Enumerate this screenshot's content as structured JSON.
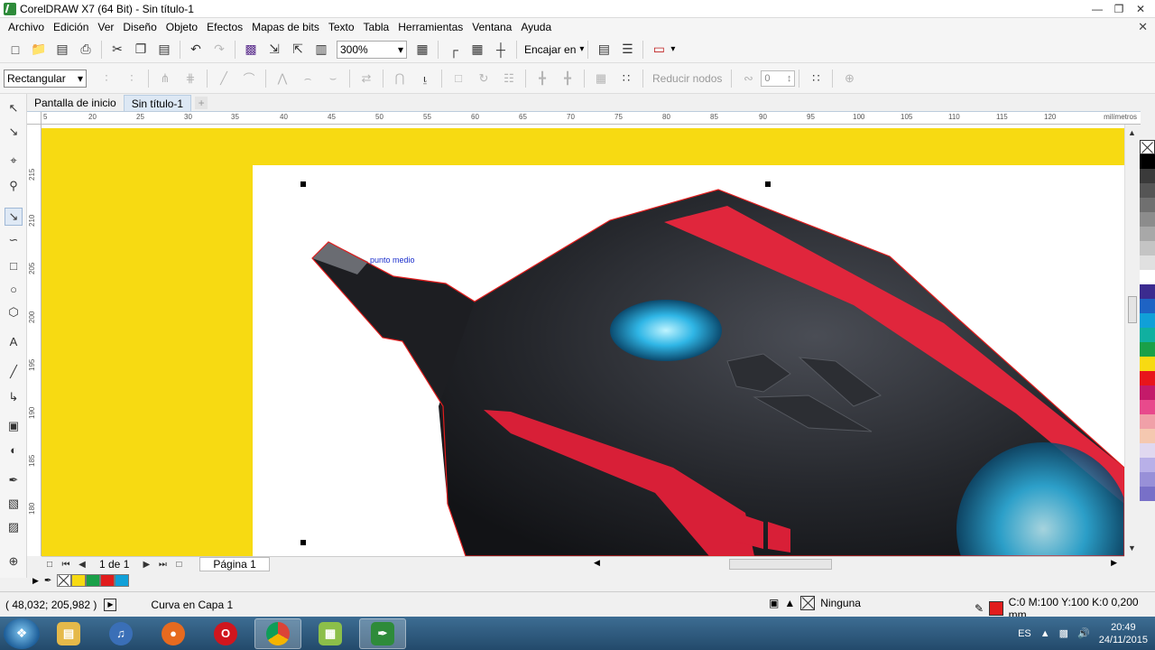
{
  "window": {
    "title": "CorelDRAW X7 (64 Bit) - Sin título-1"
  },
  "menu": [
    "Archivo",
    "Edición",
    "Ver",
    "Diseño",
    "Objeto",
    "Efectos",
    "Mapas de bits",
    "Texto",
    "Tabla",
    "Herramientas",
    "Ventana",
    "Ayuda"
  ],
  "toolbar": {
    "zoom": "300%",
    "snap_label": "Encajar en"
  },
  "property_bar": {
    "mode": "Rectangular",
    "reduce_nodes": "Reducir nodos",
    "spin_value": "0"
  },
  "tabs": [
    {
      "label": "Pantalla de inicio",
      "active": false
    },
    {
      "label": "Sin título-1",
      "active": true
    }
  ],
  "ruler": {
    "top_labels": [
      "5",
      "20",
      "25",
      "30",
      "35",
      "40",
      "45",
      "50",
      "55",
      "60",
      "65",
      "70",
      "75",
      "80",
      "85",
      "90",
      "95",
      "100",
      "105",
      "110",
      "115",
      "120"
    ],
    "left_labels": [
      "215",
      "210",
      "205",
      "200",
      "195",
      "190",
      "185",
      "180"
    ],
    "units": "milímetros"
  },
  "canvas": {
    "annotation": "punto medio"
  },
  "page_nav": {
    "count": "1 de 1",
    "page_tab": "Página 1"
  },
  "status": {
    "coords": "( 48,032; 205,982 )",
    "object": "Curva en Capa 1",
    "fill": "Ninguna",
    "outline": "C:0 M:100 Y:100 K:0  0,200 mm"
  },
  "palette_colors": [
    "#000000",
    "#3a3a3a",
    "#555555",
    "#707070",
    "#8c8c8c",
    "#a8a8a8",
    "#c4c4c4",
    "#e0e0e0",
    "#ffffff",
    "#3b2b8f",
    "#1e63c4",
    "#10a0d8",
    "#10b0a0",
    "#1aa048",
    "#f7da12",
    "#e8151b",
    "#c41a6a",
    "#e84a8c",
    "#f0a0a8",
    "#f5c8b0",
    "#e0d8f0",
    "#b8b0e8",
    "#9890d8",
    "#7870c8"
  ],
  "doc_palette": [
    "#f7da12",
    "#1aa048",
    "#e11d1d",
    "#10a0d8"
  ],
  "taskbar": {
    "lang": "ES",
    "time": "20:49",
    "date": "24/11/2015"
  }
}
